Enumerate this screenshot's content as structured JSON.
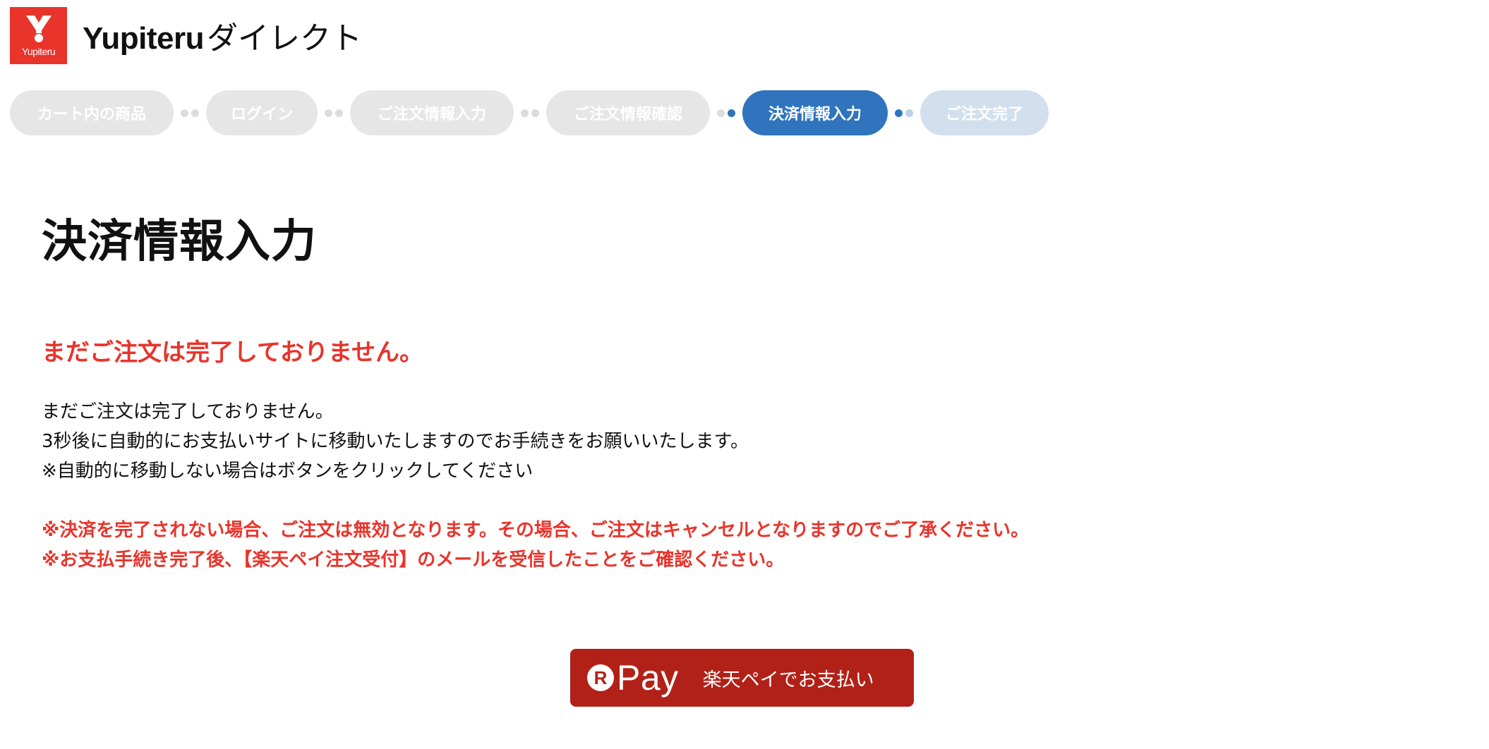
{
  "header": {
    "logo_text": "Yupiteru",
    "brand_latin": "Yupiteru",
    "brand_kana": "ダイレクト"
  },
  "steps": [
    {
      "label": "カート内の商品",
      "state": "done"
    },
    {
      "label": "ログイン",
      "state": "done"
    },
    {
      "label": "ご注文情報入力",
      "state": "done"
    },
    {
      "label": "ご注文情報確認",
      "state": "done"
    },
    {
      "label": "決済情報入力",
      "state": "active"
    },
    {
      "label": "ご注文完了",
      "state": "future"
    }
  ],
  "main": {
    "title": "決済情報入力",
    "warning_heading": "まだご注文は完了しておりません。",
    "body_lines": [
      "まだご注文は完了しておりません。",
      "3秒後に自動的にお支払いサイトに移動いたしますのでお手続きをお願いいたします。",
      "※自動的に移動しない場合はボタンをクリックしてください"
    ],
    "notes": [
      "※決済を完了されない場合、ご注文は無効となります。その場合、ご注文はキャンセルとなりますのでご了承ください。",
      "※お支払手続き完了後、【楽天ペイ注文受付】のメールを受信したことをご確認ください。"
    ]
  },
  "pay_button": {
    "r_mark": "R",
    "pay_word": "Pay",
    "label": "楽天ペイでお支払い"
  },
  "colors": {
    "brand_red": "#e8342b",
    "active_step": "#2f74bd",
    "future_step": "#d2dfed",
    "done_step": "#e6e6e6",
    "pay_button": "#b12118"
  }
}
